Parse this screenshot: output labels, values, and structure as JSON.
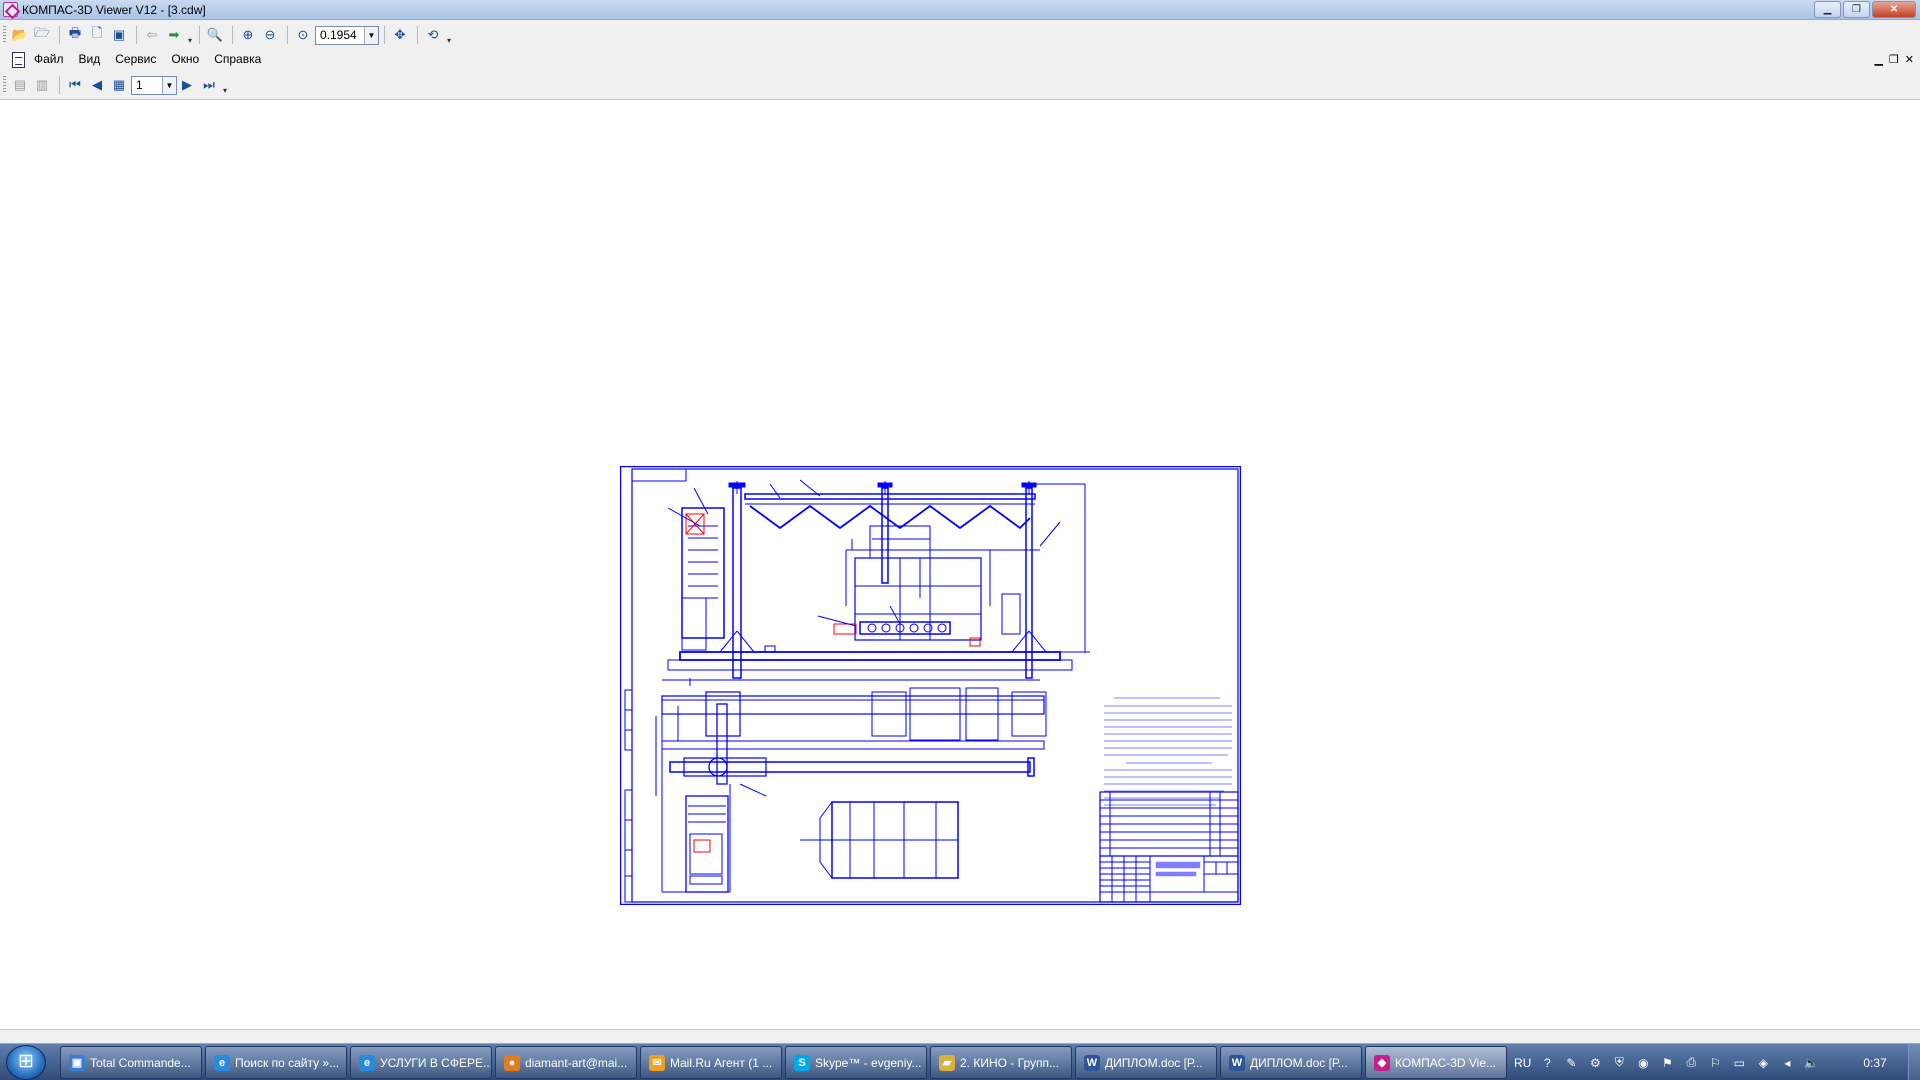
{
  "window": {
    "title": "КОМПАС-3D Viewer V12 - [3.cdw]"
  },
  "toolbar": {
    "zoom_value": "0.1954",
    "page_value": "1"
  },
  "menu": {
    "items": [
      "Файл",
      "Вид",
      "Сервис",
      "Окно",
      "Справка"
    ]
  },
  "taskbar": {
    "tasks": [
      {
        "label": "Total Commande...",
        "icon": "tc-icon",
        "color": "#3a7bd5"
      },
      {
        "label": "Поиск по сайту »...",
        "icon": "ie-icon",
        "color": "#2a8ad8"
      },
      {
        "label": "УСЛУГИ В СФЕРЕ...",
        "icon": "ie-icon",
        "color": "#2a8ad8"
      },
      {
        "label": "diamant-art@mai...",
        "icon": "browser-icon",
        "color": "#e07b20"
      },
      {
        "label": "Mail.Ru Агент (1 ...",
        "icon": "mail-icon",
        "color": "#f0a020"
      },
      {
        "label": "Skype™ - evgeniy...",
        "icon": "skype-icon",
        "color": "#00a8e8"
      },
      {
        "label": "2. КИНО - Групп...",
        "icon": "folder-icon",
        "color": "#d8b040"
      },
      {
        "label": "ДИПЛОМ.doc [Р...",
        "icon": "word-icon",
        "color": "#2b5797"
      },
      {
        "label": "ДИПЛОМ.doc [Р...",
        "icon": "word-icon",
        "color": "#2b5797"
      },
      {
        "label": "КОМПАС-3D Vie...",
        "icon": "kompas-icon",
        "color": "#c0208a"
      }
    ],
    "language": "RU",
    "clock": "0:37"
  },
  "colors": {
    "drawing_line": "#0000ff",
    "taskbar_bg": "#3f5d8f"
  }
}
